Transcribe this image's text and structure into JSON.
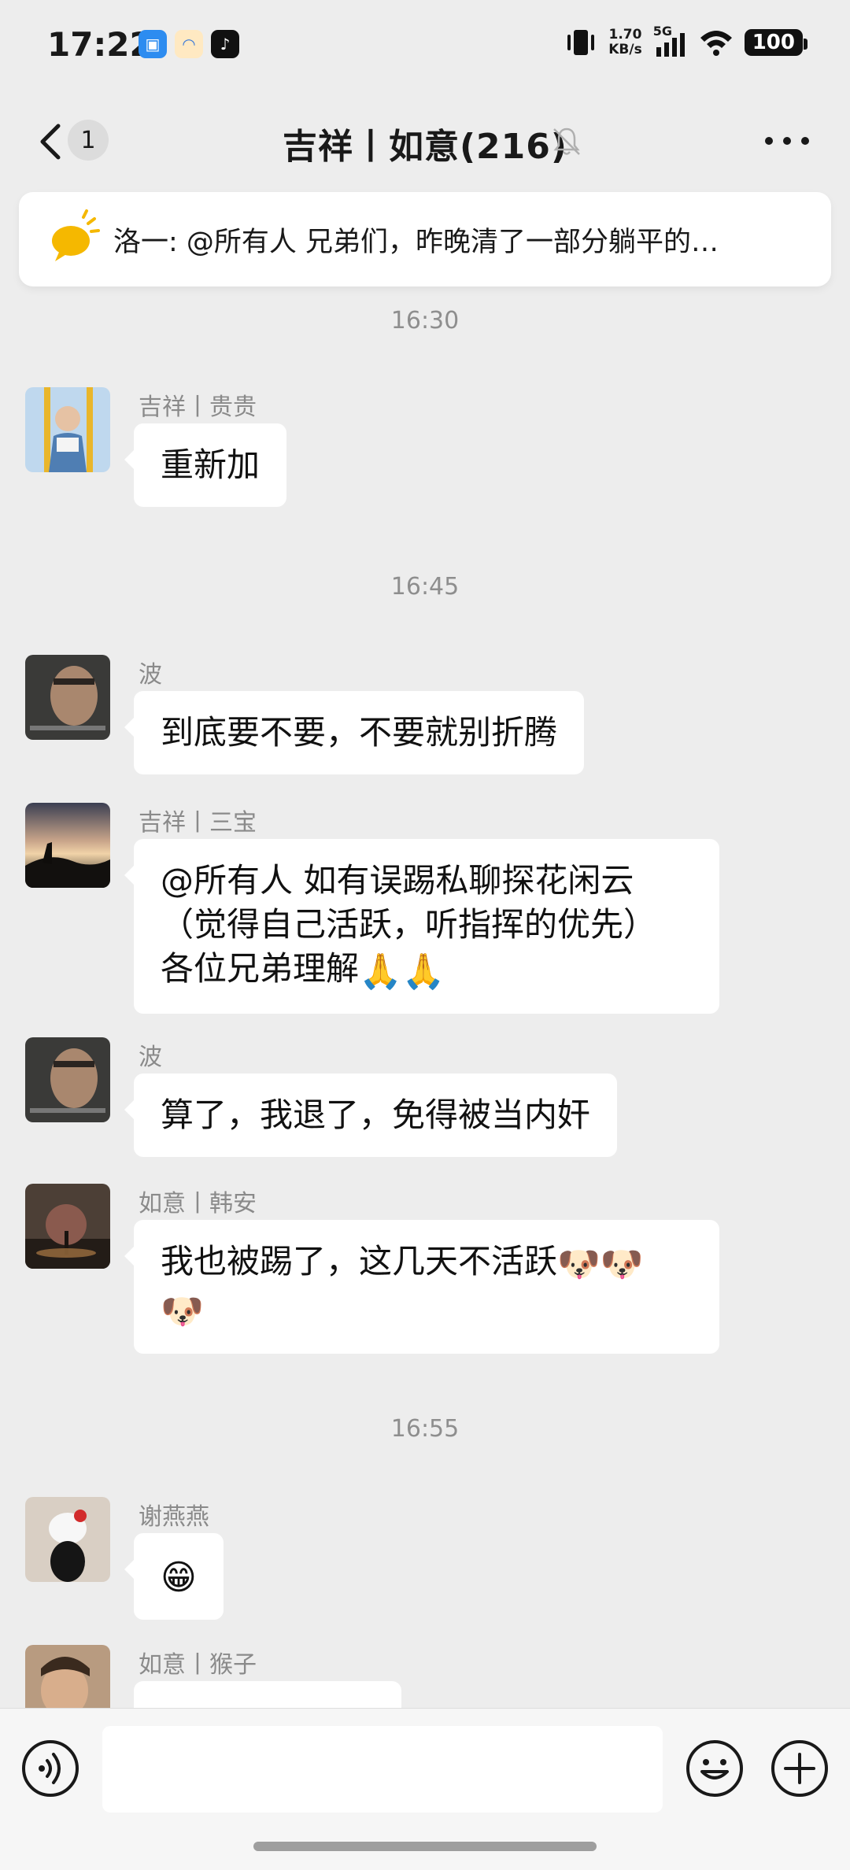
{
  "status_bar": {
    "time": "17:22",
    "speed_top": "1.70",
    "speed_bottom": "KB/s",
    "network": "5G",
    "battery": "100"
  },
  "nav": {
    "badge_count": "1",
    "title": "吉祥丨如意(216)",
    "icons": [
      "back-icon",
      "mute-bell-icon",
      "more-icon"
    ]
  },
  "pinned": {
    "text": "洛一: @所有人 兄弟们，昨晚清了一部分躺平的…"
  },
  "colors": {
    "background": "#EDEDED",
    "bubble": "#FFFFFF",
    "pinned_icon": "#F5B800",
    "timestamp": "#8E8E8E"
  },
  "chat": {
    "top_timestamp": "16:30",
    "messages": [
      {
        "sender": "吉祥丨贵贵",
        "text": "重新加"
      }
    ],
    "ts2": "16:45",
    "m2": {
      "sender": "波",
      "text": "到底要不要，不要就别折腾"
    },
    "m3": {
      "sender": "吉祥丨三宝",
      "line1": "@所有人  如有误踢私聊探花闲云",
      "line2": "（觉得自己活跃，听指挥的优先）",
      "line3": "各位兄弟理解",
      "emoji": "🙏🙏"
    },
    "m4": {
      "sender": "波",
      "text": "算了，我退了，免得被当内奸"
    },
    "m5": {
      "sender": "如意丨韩安",
      "text": "我也被踢了，这几天不活跃",
      "emoji1": "🐶🐶",
      "emoji2": "🐶"
    },
    "ts3": "16:55",
    "m6": {
      "sender": "谢燕燕",
      "emoji": "😁"
    },
    "m7": {
      "sender": "如意丨猴子"
    }
  },
  "input": {
    "icons": [
      "voice-icon",
      "emoji-icon",
      "plus-icon"
    ]
  }
}
